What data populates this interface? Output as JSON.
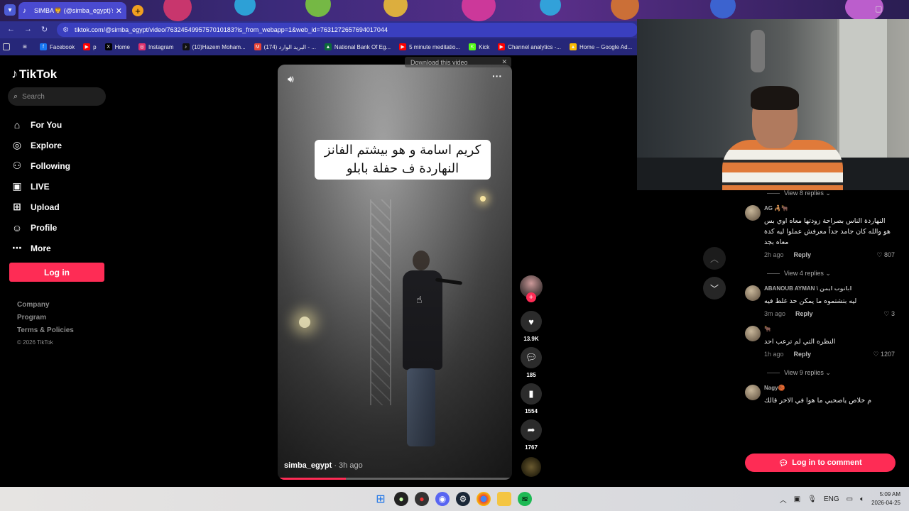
{
  "browser": {
    "tab_title": "SIMBA🦁 (@simba_egypt)'s vid",
    "url": "tiktok.com/@simba_egypt/video/7632454995757010183?is_from_webapp=1&web_id=7631272657694017044",
    "bookmarks": [
      {
        "label": "Facebook",
        "icon": "facebook-icon",
        "color": "#1877f2"
      },
      {
        "label": "p",
        "icon": "youtube-icon",
        "color": "#ff0000"
      },
      {
        "label": "Home",
        "icon": "x-icon",
        "color": "#000000"
      },
      {
        "label": "Instagram",
        "icon": "instagram-icon",
        "color": "#e1306c"
      },
      {
        "label": "(10)Hazem Moham...",
        "icon": "tiktok-icon",
        "color": "#111111"
      },
      {
        "label": "(174) البريد الوارد - ...",
        "icon": "gmail-icon",
        "color": "#ea4335"
      },
      {
        "label": "National Bank Of Eg...",
        "icon": "bank-icon",
        "color": "#0b6b3a"
      },
      {
        "label": "5 minute meditatio...",
        "icon": "youtube-icon",
        "color": "#ff0000"
      },
      {
        "label": "Kick",
        "icon": "kick-icon",
        "color": "#53fc18"
      },
      {
        "label": "Channel analytics -...",
        "icon": "youtube-icon",
        "color": "#ff0000"
      },
      {
        "label": "Home – Google Ad...",
        "icon": "google-ads-icon",
        "color": "#fbbc04"
      }
    ]
  },
  "tiktok": {
    "logo": "TikTok",
    "search_placeholder": "Search",
    "nav": [
      {
        "label": "For You",
        "icon": "home-icon"
      },
      {
        "label": "Explore",
        "icon": "compass-icon"
      },
      {
        "label": "Following",
        "icon": "following-icon"
      },
      {
        "label": "LIVE",
        "icon": "live-icon"
      },
      {
        "label": "Upload",
        "icon": "upload-icon"
      },
      {
        "label": "Profile",
        "icon": "profile-icon"
      },
      {
        "label": "More",
        "icon": "more-icon"
      }
    ],
    "login_label": "Log in",
    "footer": [
      "Company",
      "Program",
      "Terms & Policies"
    ],
    "copyright": "© 2026 TikTok"
  },
  "video": {
    "caption_line1": "كريم اسامة و هو بيشتم الفانز",
    "caption_line2": "النهاردة ف حفلة بابلو",
    "username": "simba_egypt",
    "time_ago": "3h ago",
    "download_banner": "Download this video",
    "progress": 0.29,
    "likes": "13.9K",
    "comments": "185",
    "saves": "1554",
    "shares": "1767"
  },
  "comments": {
    "top_toggle": "View 8 replies",
    "items": [
      {
        "name": "AG 🦂🐂",
        "text": "النهاردة الناس بصراحة زودتها معاه اوي بس هو والله كان جامد جداً معرفش عملوا ليه كدة معاه بجد",
        "time": "2h ago",
        "likes": "807",
        "toggle": "View 4 replies"
      },
      {
        "name": "ABANOUB AYMAN \\ ابانوب ايمن",
        "text": "ليه بتشتموه ما يمكن حد غلط فيه",
        "time": "3m ago",
        "likes": "3",
        "toggle": ""
      },
      {
        "name": "🐂",
        "text": "النظره التي لم ترعب احد",
        "time": "1h ago",
        "likes": "1207",
        "toggle": "View 9 replies"
      },
      {
        "name": "Nagy🏀",
        "text": "م خلاص ياصحبي ما هوا في الاخر قالك",
        "time": "",
        "likes": "",
        "toggle": ""
      }
    ],
    "reply_label": "Reply",
    "login_to_comment": "Log in to comment"
  },
  "taskbar": {
    "lang": "ENG",
    "time": "5:09 AM",
    "date": "2026-04-25"
  }
}
